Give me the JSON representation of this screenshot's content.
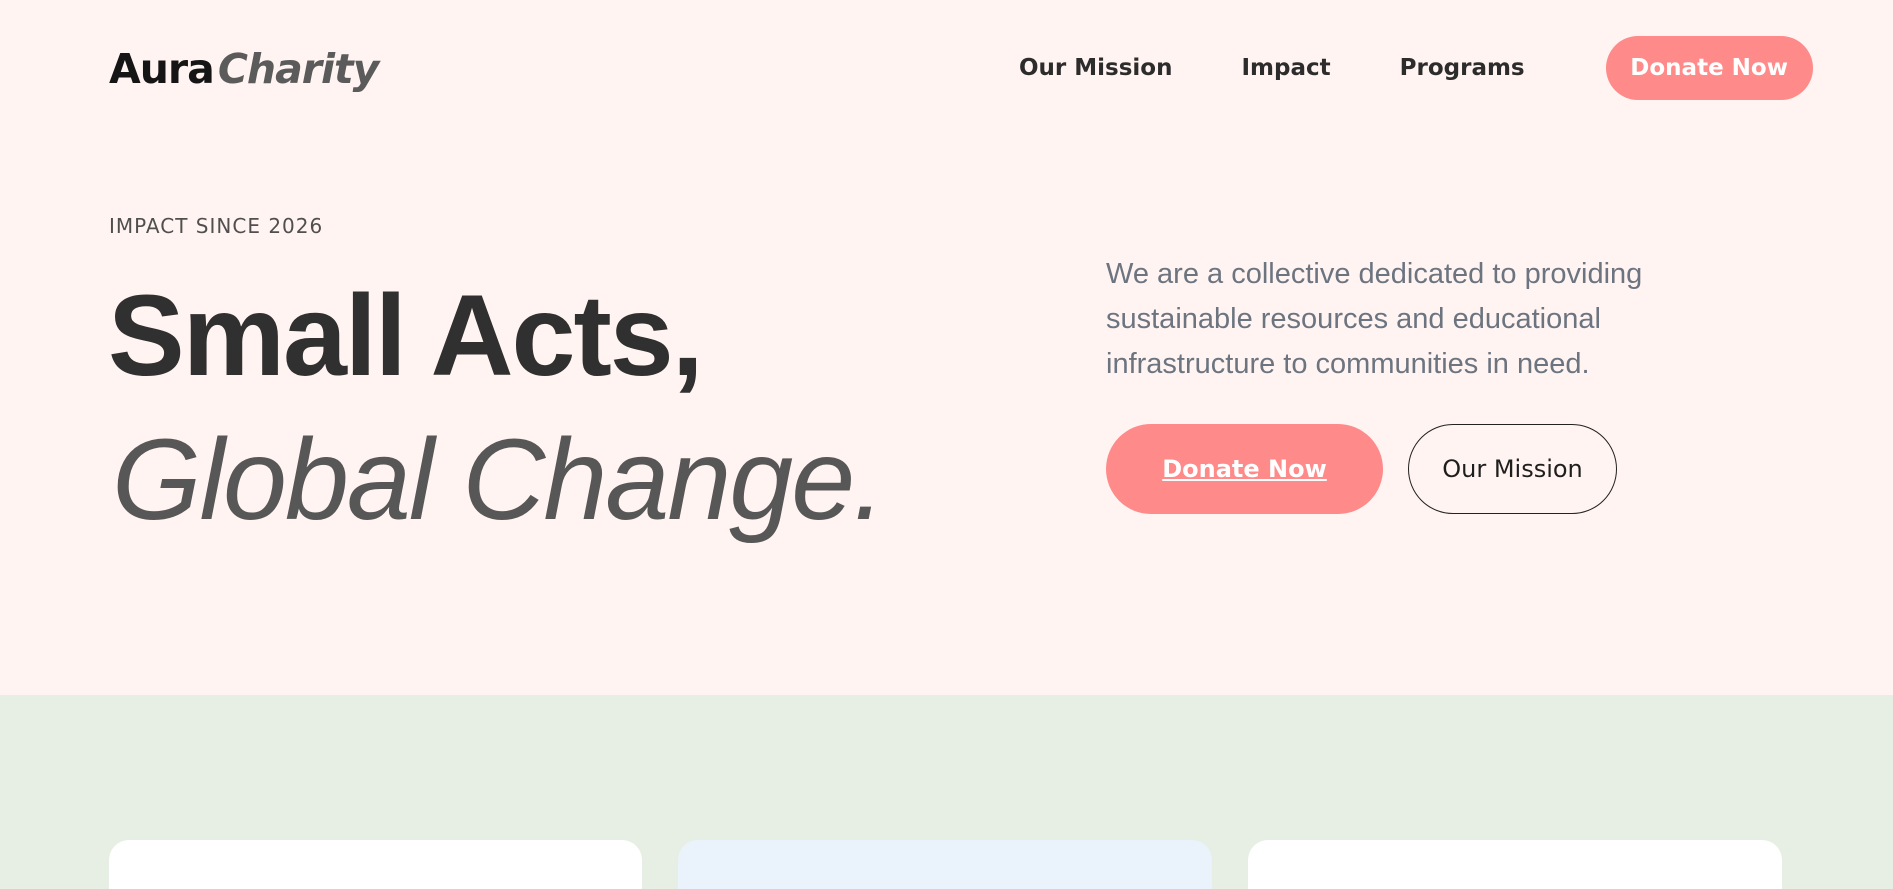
{
  "brand": {
    "name": "Aura",
    "accent": "Charity"
  },
  "nav": {
    "items": [
      {
        "label": "Our Mission"
      },
      {
        "label": "Impact"
      },
      {
        "label": "Programs"
      }
    ],
    "cta_label": "Donate Now"
  },
  "hero": {
    "eyebrow": "IMPACT SINCE 2026",
    "headline_line1": "Small Acts,",
    "headline_line2": "Global Change.",
    "description": "We are a collective dedicated to providing sustainable resources and educational infrastructure to communities in need.",
    "primary_button": "Donate Now",
    "secondary_button": "Our Mission"
  },
  "colors": {
    "hero_background": "#fff4f1",
    "accent": "#ff8a8a",
    "lower_background": "#e7efe5",
    "card_highlight": "#eaf2fc"
  }
}
